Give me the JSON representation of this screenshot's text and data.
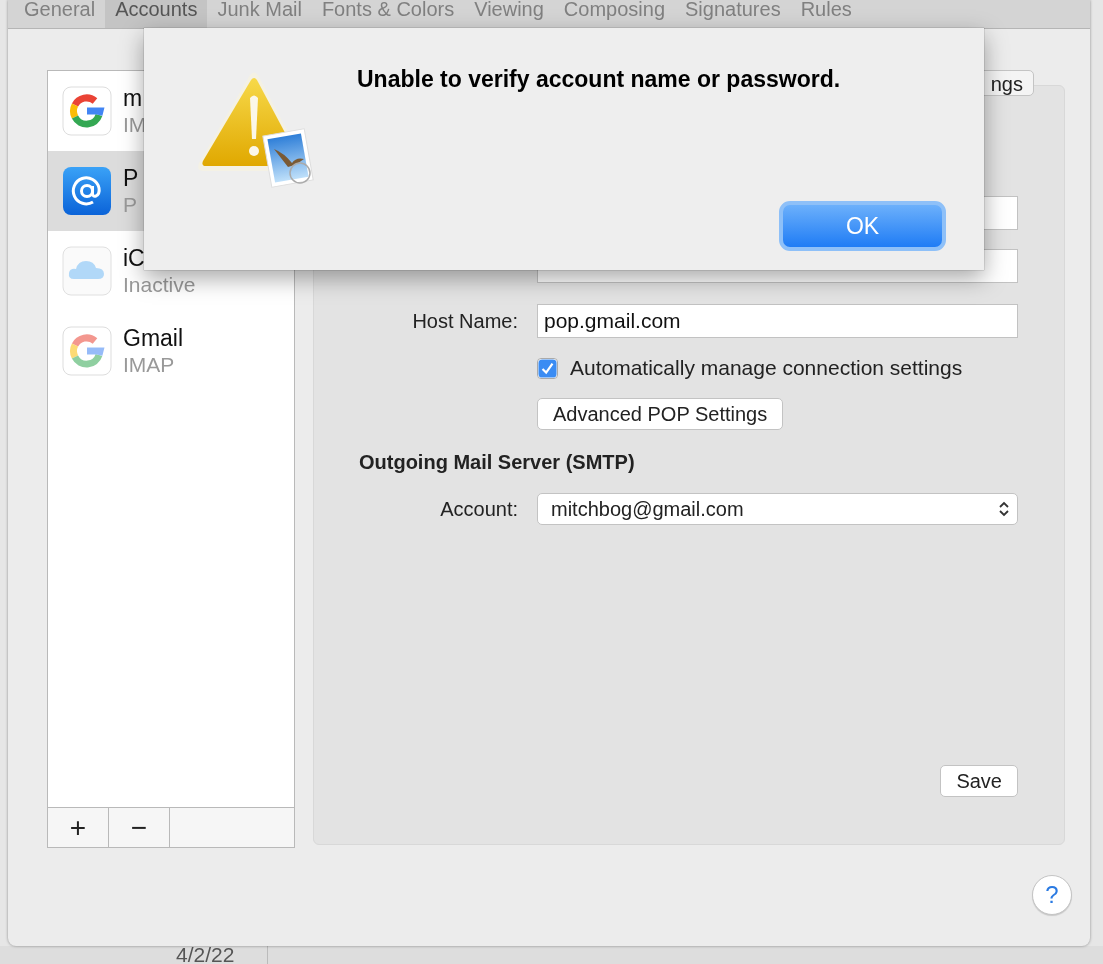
{
  "background_window": {
    "date": "4/2/22"
  },
  "tabs": [
    {
      "label": "General",
      "selected": false
    },
    {
      "label": "Accounts",
      "selected": true
    },
    {
      "label": "Junk Mail",
      "selected": false
    },
    {
      "label": "Fonts & Colors",
      "selected": false
    },
    {
      "label": "Viewing",
      "selected": false
    },
    {
      "label": "Composing",
      "selected": false
    },
    {
      "label": "Signatures",
      "selected": false
    },
    {
      "label": "Rules",
      "selected": false
    }
  ],
  "accounts": [
    {
      "kind": "google",
      "name": "m",
      "subtitle": "IM",
      "dimmed": false,
      "selected": false
    },
    {
      "kind": "pop",
      "name": "P",
      "subtitle": "P",
      "dimmed": false,
      "selected": true
    },
    {
      "kind": "icloud",
      "name": "iC",
      "subtitle": "Inactive",
      "dimmed": true,
      "selected": false
    },
    {
      "kind": "google",
      "name": "Gmail",
      "subtitle": "IMAP",
      "dimmed": true,
      "selected": false
    }
  ],
  "list_buttons": [
    "+",
    "−"
  ],
  "panel": {
    "segment_label": "ngs",
    "host_name": {
      "label": "Host Name:",
      "value": "pop.gmail.com"
    },
    "auto_manage": {
      "label": "Automatically manage connection settings",
      "checked": true
    },
    "advanced_button": "Advanced POP Settings",
    "outgoing_heading": "Outgoing Mail Server (SMTP)",
    "account": {
      "label": "Account:",
      "value": "mitchbog@gmail.com"
    },
    "save_button": "Save"
  },
  "help_button": "?",
  "dialog": {
    "message": "Unable to verify account name or password.",
    "ok_button": "OK"
  }
}
